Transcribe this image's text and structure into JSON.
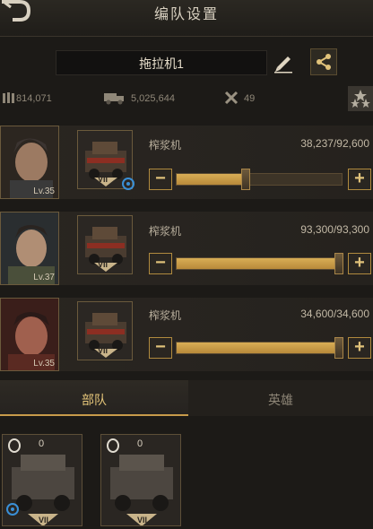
{
  "header": {
    "title": "编队设置"
  },
  "formation": {
    "name": "拖拉机1"
  },
  "stats": {
    "power": "814,071",
    "capacity": "5,025,644",
    "tools": "49"
  },
  "rows": [
    {
      "level": "Lv.35",
      "vehicle_name": "榨浆机",
      "count": "38,237/92,600",
      "tier": "VII",
      "fill": 0.41
    },
    {
      "level": "Lv.37",
      "vehicle_name": "榨浆机",
      "count": "93,300/93,300",
      "tier": "VII",
      "fill": 1.0
    },
    {
      "level": "Lv.35",
      "vehicle_name": "榨浆机",
      "count": "34,600/34,600",
      "tier": "VII",
      "fill": 1.0
    }
  ],
  "tabs": [
    {
      "label": "部队",
      "active": true
    },
    {
      "label": "英雄",
      "active": false
    }
  ],
  "units": [
    {
      "count": "0",
      "tier": "VII"
    },
    {
      "count": "0",
      "tier": "VII"
    }
  ],
  "colors": {
    "accent": "#c79b4a",
    "fill": "#d8ad55",
    "badge": "#3a8fd6"
  }
}
